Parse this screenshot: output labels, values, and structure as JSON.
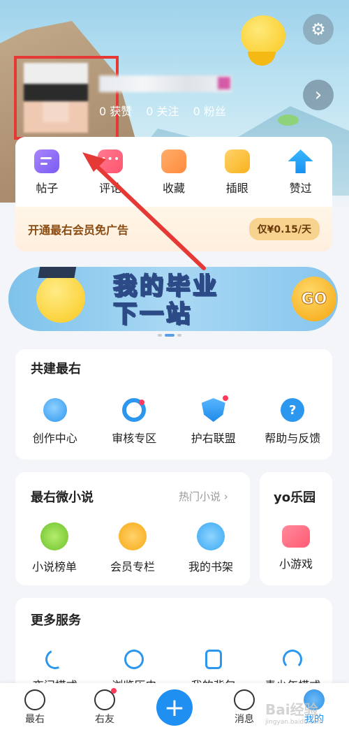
{
  "header": {
    "stats": [
      "0 获赞",
      "0 关注",
      "0 粉丝"
    ]
  },
  "quick_actions": [
    {
      "label": "帖子",
      "icon": "post-icon"
    },
    {
      "label": "评论",
      "icon": "comment-icon"
    },
    {
      "label": "收藏",
      "icon": "folder-icon"
    },
    {
      "label": "插眼",
      "icon": "eye-icon"
    },
    {
      "label": "赞过",
      "icon": "thumbs-up-icon"
    }
  ],
  "vip_bar": {
    "text": "开通最右会员免广告",
    "price": "仅¥0.15/天"
  },
  "banner": {
    "line1": "我的毕业",
    "line2": "下一站",
    "go": "GO"
  },
  "build": {
    "title": "共建最右",
    "items": [
      {
        "label": "创作中心",
        "icon": "bulb-icon",
        "dot": false
      },
      {
        "label": "审核专区",
        "icon": "search-icon",
        "dot": true
      },
      {
        "label": "护右联盟",
        "icon": "shield-icon",
        "dot": true
      },
      {
        "label": "帮助与反馈",
        "icon": "help-icon",
        "dot": false
      }
    ]
  },
  "novel": {
    "title": "最右微小说",
    "hot_link": "热门小说 ›",
    "items": [
      {
        "label": "小说榜单",
        "icon": "ranking-icon"
      },
      {
        "label": "会员专栏",
        "icon": "crown-icon"
      },
      {
        "label": "我的书架",
        "icon": "book-icon"
      }
    ]
  },
  "yo": {
    "title": "yo乐园",
    "items": [
      {
        "label": "小游戏",
        "icon": "gamepad-icon"
      }
    ]
  },
  "more": {
    "title": "更多服务",
    "items": [
      {
        "label": "夜间模式",
        "icon": "moon-icon"
      },
      {
        "label": "浏览历史",
        "icon": "clock-icon"
      },
      {
        "label": "我的背包",
        "icon": "backpack-icon"
      },
      {
        "label": "青少年模式",
        "icon": "umbrella-icon"
      }
    ]
  },
  "bottom_nav": [
    {
      "label": "最右",
      "icon": "home-face-icon"
    },
    {
      "label": "右友",
      "icon": "planet-icon"
    },
    {
      "label": "+",
      "icon": "add-icon"
    },
    {
      "label": "消息",
      "icon": "message-face-icon"
    },
    {
      "label": "我的",
      "icon": "me-icon"
    }
  ],
  "watermark": {
    "text": "Bai经验",
    "sub": "jingyan.baidu.com"
  },
  "colors": {
    "accent": "#1f8ff2",
    "highlight": "#e53935",
    "vip_text": "#8a4a10"
  }
}
